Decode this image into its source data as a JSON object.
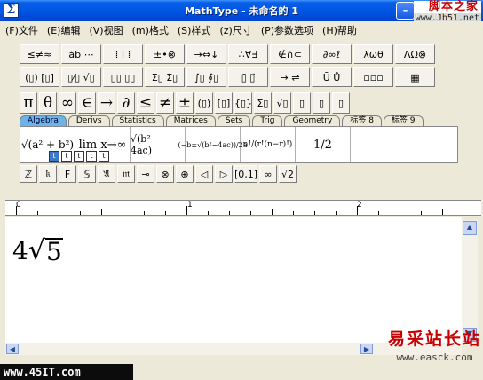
{
  "window": {
    "app_icon": "Σ",
    "title": "MathType - 未命名的 1",
    "controls": {
      "minimize": "–",
      "maximize": "□",
      "close": "✕"
    }
  },
  "watermarks": {
    "top_right_name": "脚本之家",
    "top_right_url": "www.Jb51.net",
    "bottom_left": "www.45IT.com",
    "bottom_right_name": "易采站长站",
    "bottom_right_url": "www.easck.com"
  },
  "menu": [
    {
      "label": "(F)文件"
    },
    {
      "label": "(E)编辑"
    },
    {
      "label": "(V)视图"
    },
    {
      "label": "(m)格式"
    },
    {
      "label": "(S)样式"
    },
    {
      "label": "(z)尺寸"
    },
    {
      "label": "(P)参数选项"
    },
    {
      "label": "(H)帮助"
    }
  ],
  "symbol_row_1": [
    "≤≠≈",
    "ȧb ⋯",
    "⁞ ⁞ ⁞",
    "±•⊗",
    "→⇔↓",
    "∴∀∃",
    "∉∩⊂",
    "∂∞ℓ",
    "λωθ",
    "ΛΩ⊗"
  ],
  "symbol_row_2": [
    "(▯) [▯]",
    "▯⁄▯ √▯",
    "▯▯ ▯▯",
    "Σ▯ Σ▯",
    "∫▯ ∮▯",
    "▯̄ ▯⃗",
    "→ ⇌",
    "Ū Ů",
    "▫▫▫",
    "▦"
  ],
  "symbol_row_3": [
    "π",
    "θ",
    "∞",
    "∈",
    "→",
    "∂",
    "≤",
    "≠",
    "±",
    "(▯)",
    "[▯]",
    "{▯}",
    "Σ▯",
    "√▯",
    "▯",
    "▯",
    "▯"
  ],
  "template_tabs": [
    {
      "label": "Algebra",
      "active": true
    },
    {
      "label": "Derivs",
      "active": false
    },
    {
      "label": "Statistics",
      "active": false
    },
    {
      "label": "Matrices",
      "active": false
    },
    {
      "label": "Sets",
      "active": false
    },
    {
      "label": "Trig",
      "active": false
    },
    {
      "label": "Geometry",
      "active": false
    },
    {
      "label": "标签 8",
      "active": false
    },
    {
      "label": "标签 9",
      "active": false
    }
  ],
  "templates": [
    "√(a² + b²)",
    "lim x→∞",
    "√(b² − 4ac)",
    "(−b±√(b²−4ac))/2a",
    "n!/(r!(n−r)!)",
    "1/2"
  ],
  "small_palette": [
    "ℤ",
    "𝔨",
    "F",
    "𝕊",
    "𝔄",
    "𝔪",
    "⊸",
    "⊗",
    "⊕",
    "◁",
    "▷",
    "[0,1]",
    "∞",
    "√2"
  ],
  "mode_buttons": [
    {
      "label": "t",
      "selected": true
    },
    {
      "label": "t",
      "selected": false
    },
    {
      "label": "t",
      "selected": false
    },
    {
      "label": "t",
      "selected": false
    },
    {
      "label": "t",
      "selected": false
    }
  ],
  "ruler": {
    "marks": [
      "0",
      "1",
      "2"
    ]
  },
  "equation": {
    "coefficient": "4",
    "radicand": "5"
  },
  "scrollbars": {
    "up": "▲",
    "down": "▼",
    "left": "◀",
    "right": "▶"
  }
}
